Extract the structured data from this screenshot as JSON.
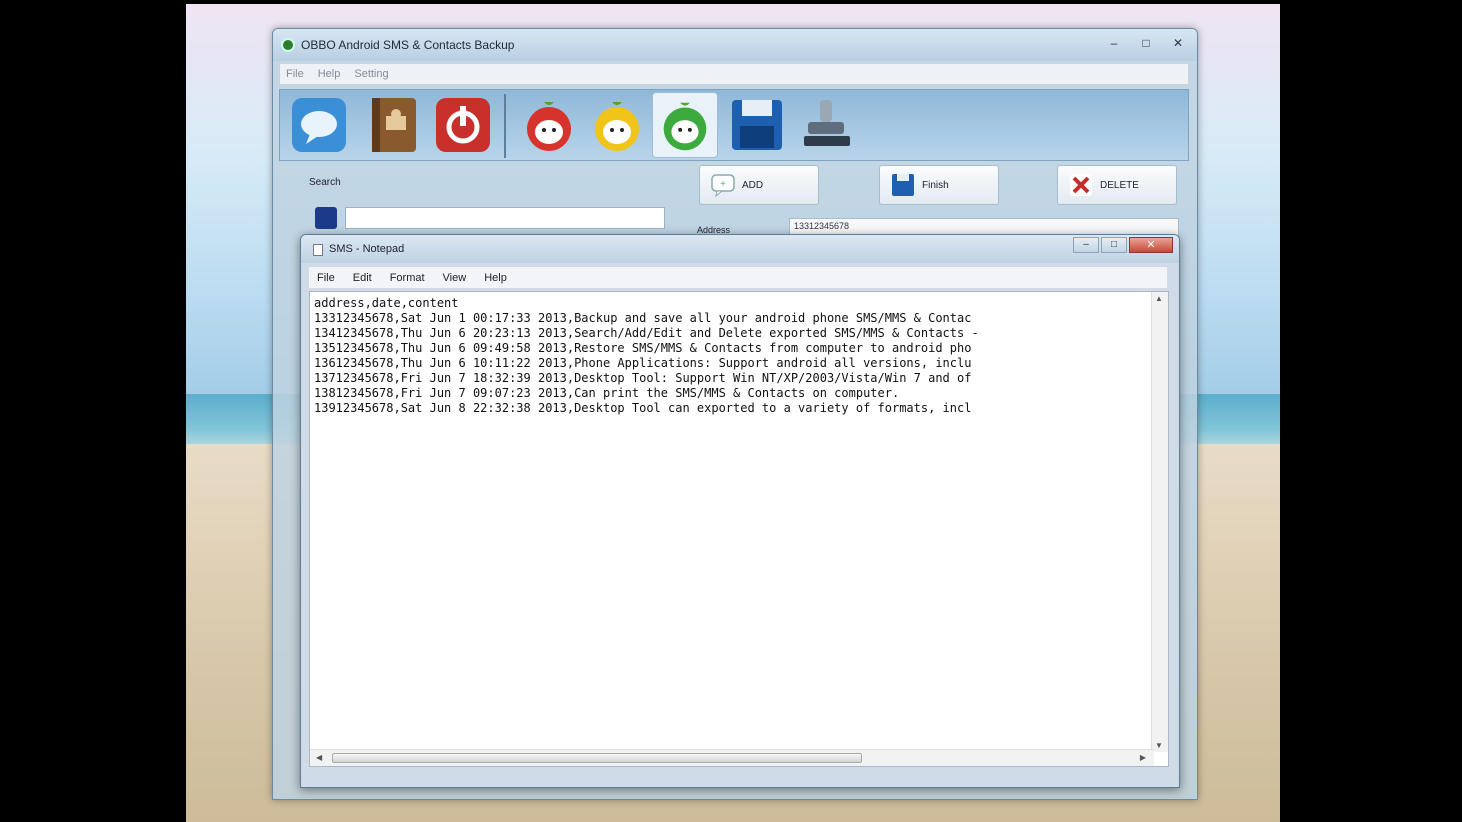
{
  "app": {
    "title": "OBBO Android SMS & Contacts Backup",
    "menu": [
      "File",
      "Help",
      "Setting"
    ],
    "window_buttons": [
      "–",
      "□",
      "✕"
    ],
    "toolbar_icons": [
      "message-icon",
      "contacts-book-icon",
      "power-icon",
      "apple-face-icon",
      "yellow-face-icon",
      "green-face-icon",
      "floppy-save-icon",
      "stamp-icon"
    ],
    "search_label": "Search",
    "buttons": {
      "add": "ADD",
      "finish": "Finish",
      "delete": "DELETE"
    },
    "address_label": "Address",
    "address_value": "13312345678"
  },
  "notepad": {
    "title": "SMS - Notepad",
    "menu": [
      "File",
      "Edit",
      "Format",
      "View",
      "Help"
    ],
    "window_buttons": [
      "–",
      "□",
      "✕"
    ],
    "lines": [
      "address,date,content",
      "13312345678,Sat Jun 1 00:17:33 2013,Backup and save all your android phone SMS/MMS & Contac",
      "13412345678,Thu Jun 6 20:23:13 2013,Search/Add/Edit and Delete exported SMS/MMS & Contacts -",
      "13512345678,Thu Jun 6 09:49:58 2013,Restore SMS/MMS & Contacts from computer to android pho",
      "13612345678,Thu Jun 6 10:11:22 2013,Phone Applications: Support android all versions, inclu",
      "13712345678,Fri Jun 7 18:32:39 2013,Desktop Tool: Support Win NT/XP/2003/Vista/Win 7 and of",
      "13812345678,Fri Jun 7 09:07:23 2013,Can print the SMS/MMS & Contacts on computer.",
      "13912345678,Sat Jun 8 22:32:38 2013,Desktop Tool can exported to a variety of formats, incl"
    ]
  }
}
